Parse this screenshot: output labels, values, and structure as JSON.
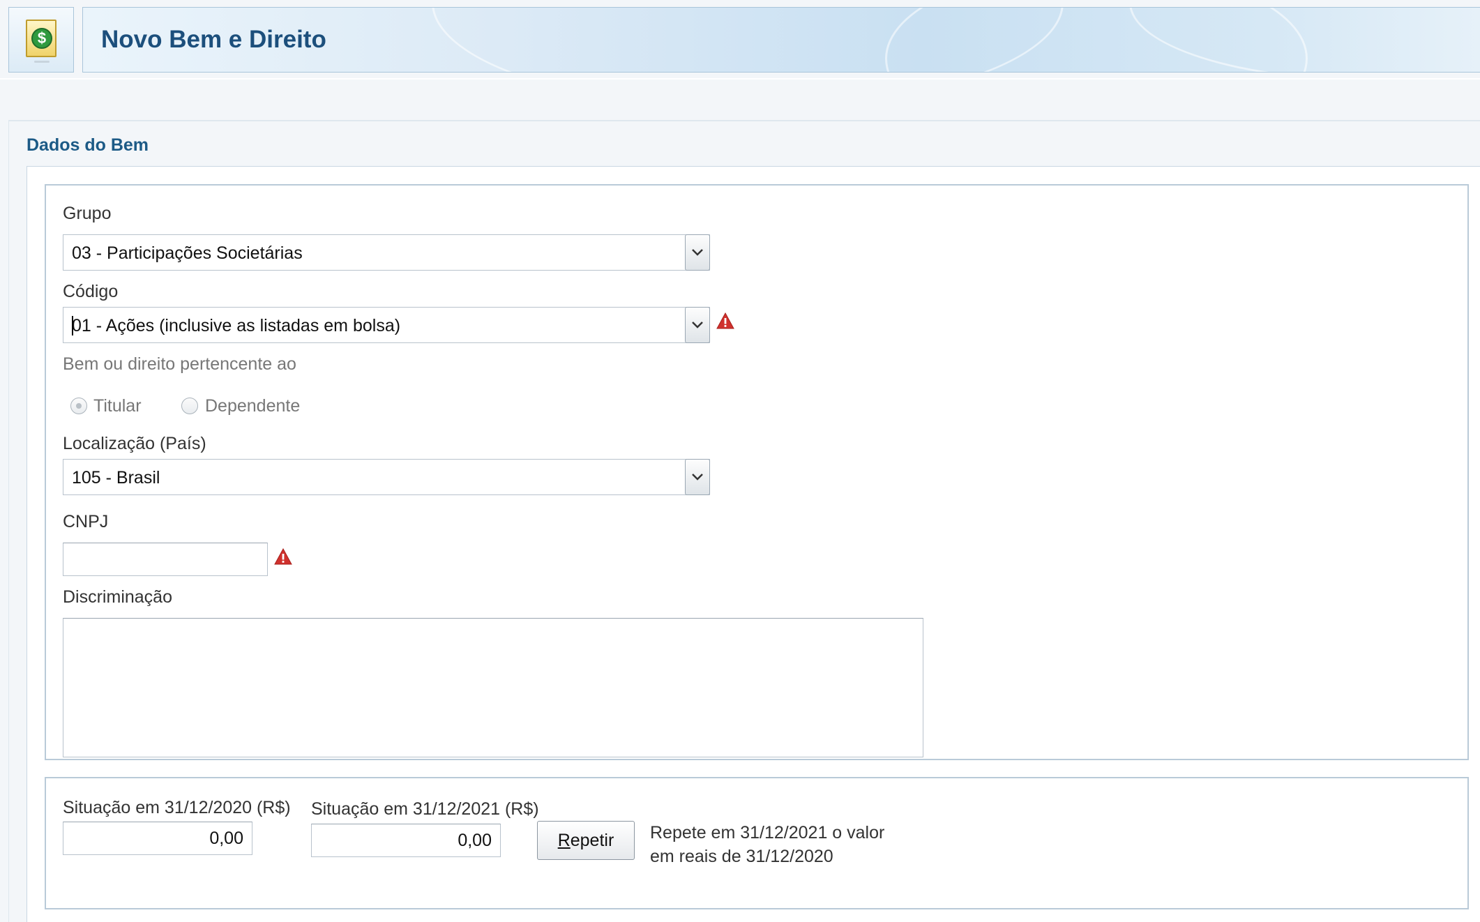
{
  "header": {
    "title": "Novo Bem e Direito",
    "icon": "money-document-icon"
  },
  "section": {
    "title": "Dados do Bem"
  },
  "form": {
    "grupo": {
      "label": "Grupo",
      "value": "03 - Participações Societárias"
    },
    "codigo": {
      "label": "Código",
      "value": "01 - Ações (inclusive as listadas em bolsa)",
      "warning": true
    },
    "pertencente": {
      "label": "Bem ou direito pertencente ao",
      "options": [
        "Titular",
        "Dependente"
      ],
      "selected": "Titular",
      "enabled": false
    },
    "localizacao": {
      "label": "Localização (País)",
      "value": "105 - Brasil"
    },
    "cnpj": {
      "label": "CNPJ",
      "value": "",
      "warning": true
    },
    "discriminacao": {
      "label": "Discriminação",
      "value": ""
    }
  },
  "situacao": {
    "s2020": {
      "label": "Situação em 31/12/2020 (R$)",
      "value": "0,00"
    },
    "s2021": {
      "label": "Situação em 31/12/2021 (R$)",
      "value": "0,00"
    },
    "repeat_button": {
      "mnemonic": "R",
      "rest": "epetir"
    },
    "repeat_hint_line1": "Repete em 31/12/2021 o valor",
    "repeat_hint_line2": "em reais de 31/12/2020"
  },
  "colors": {
    "title": "#1c4f7c",
    "section_title": "#1c5a86",
    "warning": "#d0312d"
  }
}
